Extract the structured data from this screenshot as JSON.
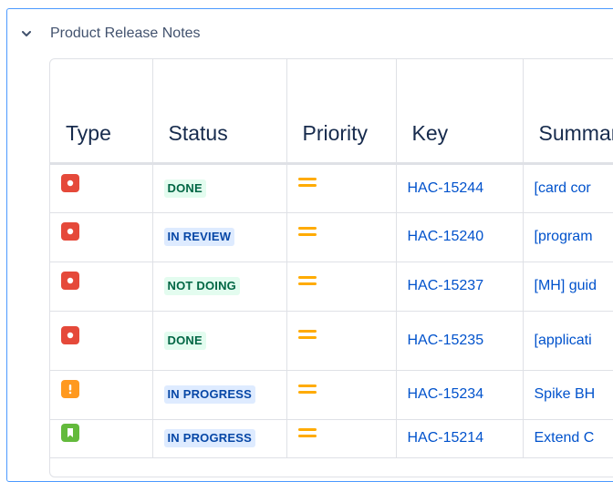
{
  "macro": {
    "title": "Product Release Notes"
  },
  "table": {
    "headers": [
      "Type",
      "Status",
      "Priority",
      "Key",
      "Summary"
    ],
    "rows": [
      {
        "type": "bug",
        "status": "DONE",
        "status_kind": "success",
        "priority": "medium",
        "key": "HAC-15244",
        "summary": "[card cor"
      },
      {
        "type": "bug",
        "status": "IN REVIEW",
        "status_kind": "progress",
        "priority": "medium",
        "key": "HAC-15240",
        "summary": "[program"
      },
      {
        "type": "bug",
        "status": "NOT DOING",
        "status_kind": "success",
        "priority": "medium",
        "key": "HAC-15237",
        "summary": "[MH] guid"
      },
      {
        "type": "bug",
        "status": "DONE",
        "status_kind": "success",
        "priority": "medium",
        "key": "HAC-15235",
        "summary": "[applicati"
      },
      {
        "type": "improvement",
        "status": "IN PROGRESS",
        "status_kind": "progress",
        "priority": "medium",
        "key": "HAC-15234",
        "summary": "Spike BH"
      },
      {
        "type": "story",
        "status": "IN PROGRESS",
        "status_kind": "progress",
        "priority": "medium",
        "key": "HAC-15214",
        "summary": "Extend C"
      }
    ]
  },
  "colors": {
    "bug": "#e5493a",
    "improvement": "#ff991f",
    "story": "#63ba3c",
    "priority_medium": "#ffab00",
    "link": "#0052cc"
  }
}
